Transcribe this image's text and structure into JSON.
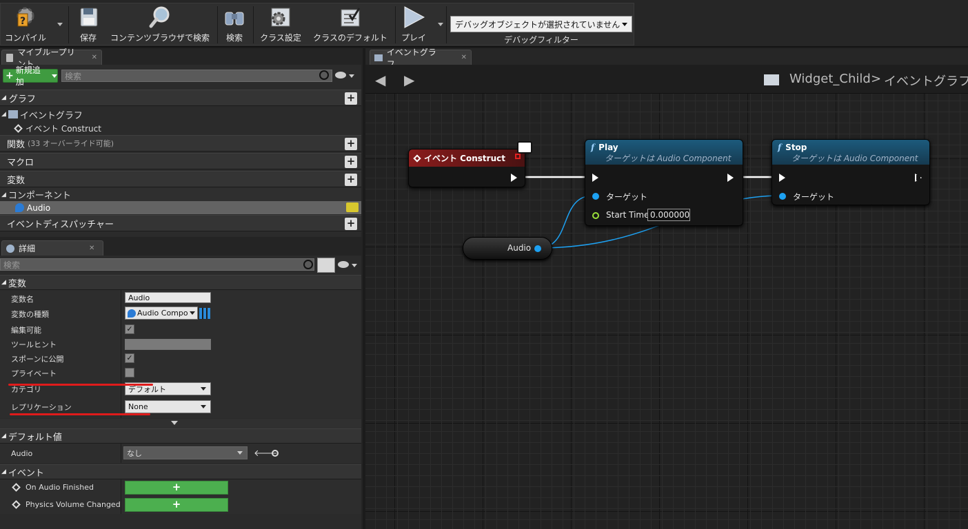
{
  "toolbar": {
    "compile": "コンパイル",
    "save": "保存",
    "content_browser": "コンテンツブラウザで検索",
    "search": "検索",
    "class_settings": "クラス設定",
    "class_defaults": "クラスのデフォルト",
    "play": "プレイ",
    "debug_object": "デバッグオブジェクトが選択されていません",
    "debug_filter": "デバッグフィルター"
  },
  "my_blueprint": {
    "tab": "マイブループリント",
    "add_new": "新規追加",
    "search_placeholder": "検索",
    "graphs": "グラフ",
    "event_graph": "イベントグラフ",
    "event_construct": "イベント Construct",
    "functions": "関数",
    "functions_note": "(33 オーバーライド可能)",
    "macros": "マクロ",
    "variables": "変数",
    "components": "コンポーネント",
    "audio": "Audio",
    "dispatchers": "イベントディスパッチャー"
  },
  "details": {
    "tab": "詳細",
    "search_placeholder": "検索",
    "section_variable": "変数",
    "var_name_label": "変数名",
    "var_name_value": "Audio",
    "var_type_label": "変数の種類",
    "var_type_value": "Audio Component",
    "editable_label": "編集可能",
    "tooltip_label": "ツールヒント",
    "expose_label": "スポーンに公開",
    "private_label": "プライベート",
    "category_label": "カテゴリ",
    "category_value": "デフォルト",
    "replication_label": "レプリケーション",
    "replication_value": "None",
    "section_default": "デフォルト値",
    "default_audio_label": "Audio",
    "default_audio_value": "なし",
    "section_events": "イベント",
    "event1": "On Audio Finished",
    "event2": "Physics Volume Changed",
    "editable_checked": true,
    "expose_checked": true,
    "private_checked": false
  },
  "graph": {
    "tab": "イベントグラフ",
    "breadcrumb_bp": "Widget_Child",
    "breadcrumb_sep": ">",
    "breadcrumb_graph": "イベントグラフ",
    "node_construct": "イベント Construct",
    "node_play_title": "Play",
    "node_play_sub": "ターゲットは Audio Component",
    "node_stop_title": "Stop",
    "node_stop_sub": "ターゲットは Audio Component",
    "pin_target": "ターゲット",
    "pin_start_time": "Start Time",
    "start_time_value": "0.000000",
    "var_node": "Audio"
  }
}
